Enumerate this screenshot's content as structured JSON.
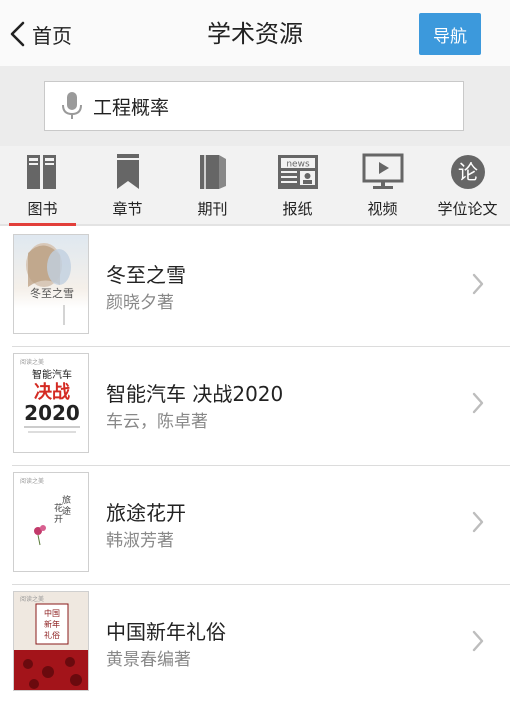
{
  "header": {
    "back_label": "首页",
    "title": "学术资源",
    "nav_button": "导航"
  },
  "search": {
    "value": "工程概率",
    "placeholder": ""
  },
  "tabs": [
    {
      "label": "图书",
      "icon": "books-icon",
      "active": true
    },
    {
      "label": "章节",
      "icon": "bookmark-icon",
      "active": false
    },
    {
      "label": "期刊",
      "icon": "journal-icon",
      "active": false
    },
    {
      "label": "报纸",
      "icon": "newspaper-icon",
      "active": false
    },
    {
      "label": "视频",
      "icon": "video-icon",
      "active": false
    },
    {
      "label": "学位论文",
      "icon": "thesis-icon",
      "active": false
    }
  ],
  "books": [
    {
      "title": "冬至之雪",
      "author": "颜晓夕著",
      "cover_text": "冬至之雪"
    },
    {
      "title": "智能汽车 决战2020",
      "author": "车云，陈卓著",
      "cover_text": "智能汽车 决战 2020",
      "cover_badge": "阅读之美"
    },
    {
      "title": "旅途花开",
      "author": "韩淑芳著",
      "cover_text": "旅途花开",
      "cover_badge": "阅读之美"
    },
    {
      "title": "中国新年礼俗",
      "author": "黄景春编著",
      "cover_text": "中国新年礼俗",
      "cover_badge": "阅读之美"
    }
  ],
  "colors": {
    "accent": "#3c99dc",
    "active_underline": "#e23f3a",
    "icon_gray": "#666666"
  }
}
